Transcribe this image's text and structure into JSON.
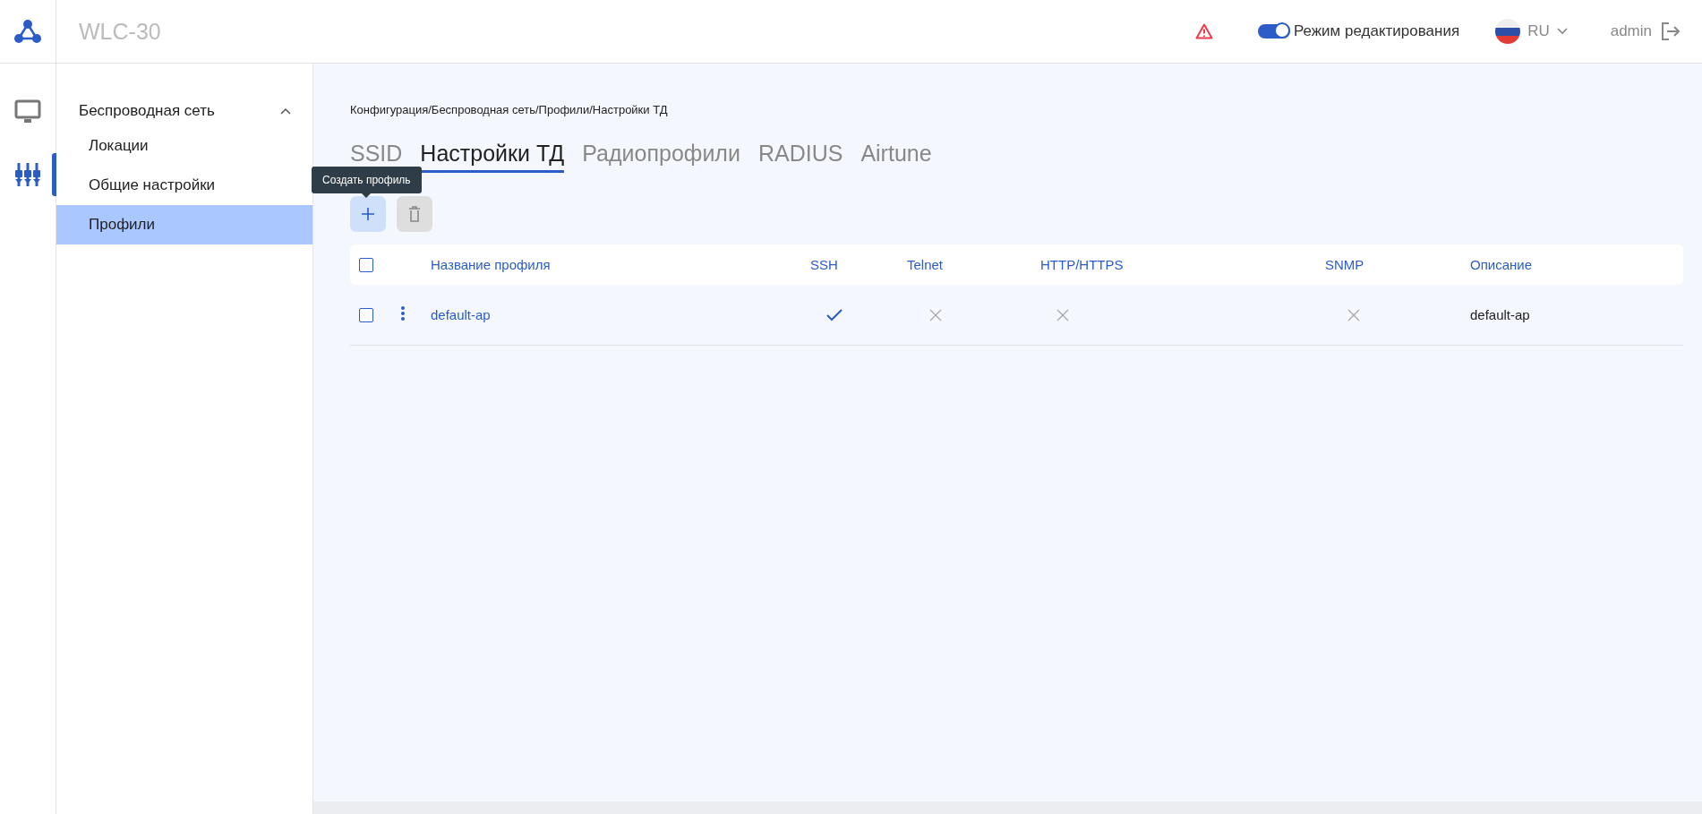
{
  "header": {
    "title": "WLC-30",
    "edit_mode": {
      "label": "Режим редактирования",
      "on": true
    },
    "language": "RU",
    "user": "admin"
  },
  "nav_rail": [
    {
      "kind": "monitor",
      "selected": false
    },
    {
      "kind": "config",
      "selected": true
    }
  ],
  "sidebar": {
    "group": {
      "label": "Беспроводная сеть",
      "expanded": true,
      "items": [
        {
          "label": "Локации",
          "selected": false
        },
        {
          "label": "Общие настройки",
          "selected": false
        },
        {
          "label": "Профили",
          "selected": true
        }
      ]
    }
  },
  "breadcrumb": "Конфигурация/Беспроводная сеть/Профили/Настройки ТД",
  "tabs": [
    {
      "label": "SSID",
      "selected": false
    },
    {
      "label": "Настройки ТД",
      "selected": true
    },
    {
      "label": "Радиопрофили",
      "selected": false
    },
    {
      "label": "RADIUS",
      "selected": false
    },
    {
      "label": "Airtune",
      "selected": false
    }
  ],
  "tooltip": "Создать профиль",
  "table": {
    "select_all_checked": false,
    "columns": [
      "Название профиля",
      "SSH",
      "Telnet",
      "HTTP/HTTPS",
      "SNMP",
      "Описание"
    ],
    "rows": [
      {
        "checked": false,
        "name": "default-ap",
        "ssh": true,
        "telnet": false,
        "http": false,
        "snmp": false,
        "description": "default-ap"
      }
    ]
  }
}
